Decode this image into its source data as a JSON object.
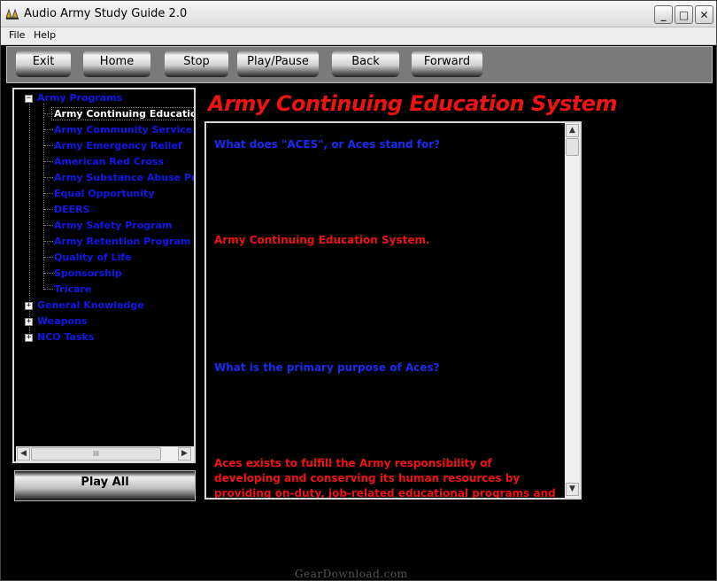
{
  "window": {
    "title": "Audio Army Study Guide 2.0",
    "controls": {
      "minimize": "_",
      "maximize": "□",
      "close": "✕"
    }
  },
  "menu": [
    "File",
    "Help"
  ],
  "toolbar": [
    "Exit",
    "Home",
    "Stop",
    "Play/Pause",
    "Back",
    "Forward"
  ],
  "tree": {
    "root": "Army Programs",
    "children": [
      "Army Continuing Education System",
      "Army Community Service",
      "Army Emergency Relief",
      "American Red Cross",
      "Army Substance Abuse Program",
      "Equal Opportunity",
      "DEERS",
      "Army Safety Program",
      "Army Retention Program",
      "Quality of Life",
      "Sponsorship",
      "Tricare"
    ],
    "selected_index": 0,
    "collapsed": [
      "General Knowledge",
      "Weapons",
      "NCO Tasks"
    ]
  },
  "play_all": "Play All",
  "content": {
    "heading": "Army Continuing Education System",
    "items": [
      {
        "type": "question",
        "text": "What does \"ACES\", or Aces stand for?"
      },
      {
        "type": "answer",
        "text": "Army Continuing Education System."
      },
      {
        "type": "question",
        "text": "What is the primary purpose of Aces?"
      },
      {
        "type": "answer",
        "text": "Aces exists to fulfill the Army responsibility of developing and conserving its human resources by providing on-duty, job-related educational programs and off-duty educational"
      }
    ]
  },
  "colors": {
    "question": "#1a2bf0",
    "answer": "#ee1212",
    "heading": "#ee1212",
    "tree_text": "#1218e8",
    "background": "#000000"
  },
  "watermark": "GearDownload.com"
}
